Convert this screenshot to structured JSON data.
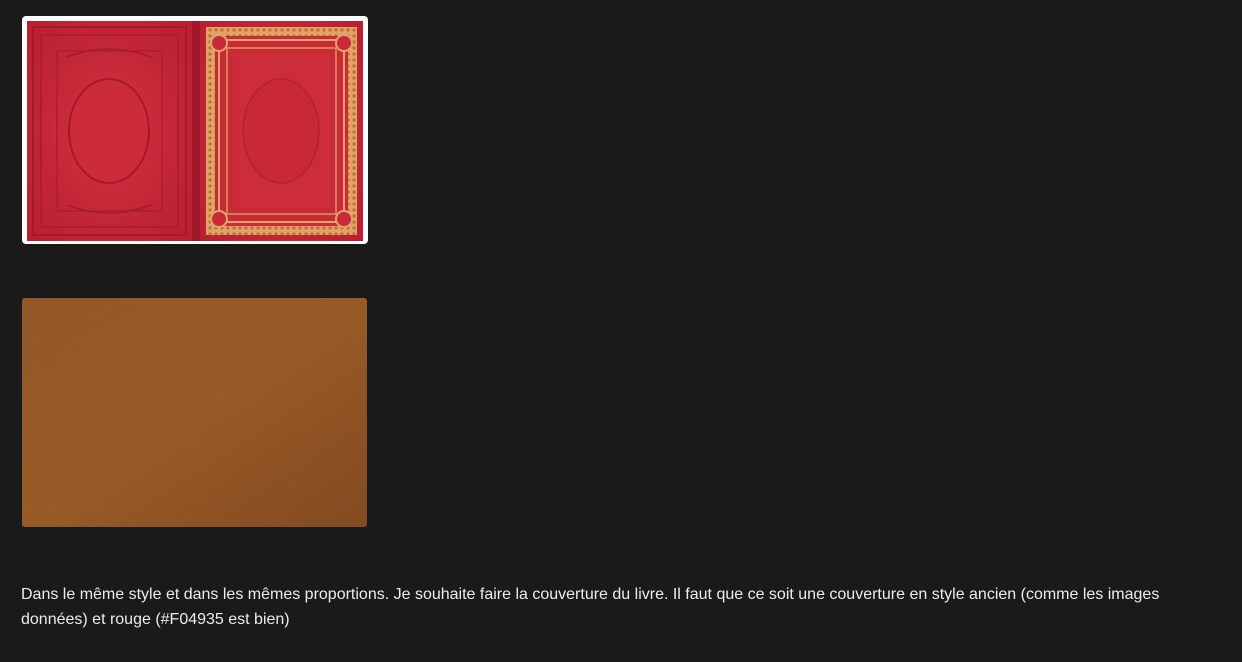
{
  "attachments": [
    {
      "kind": "image",
      "depicts": "open red antique book cover with ornate gilded border",
      "colors": {
        "leather": "#c8283a",
        "gold": "#d89a5a"
      }
    },
    {
      "kind": "image",
      "depicts": "brown leather texture",
      "colors": {
        "leather": "#8a4a1e"
      }
    }
  ],
  "message": {
    "text": "Dans le même style et dans les mêmes proportions. Je souhaite faire la couverture du livre. Il faut que ce soit une couverture en style ancien (comme les images données) et rouge (#F04935 est bien)"
  },
  "theme": {
    "background": "#1a1a1a",
    "text": "#ececec"
  }
}
